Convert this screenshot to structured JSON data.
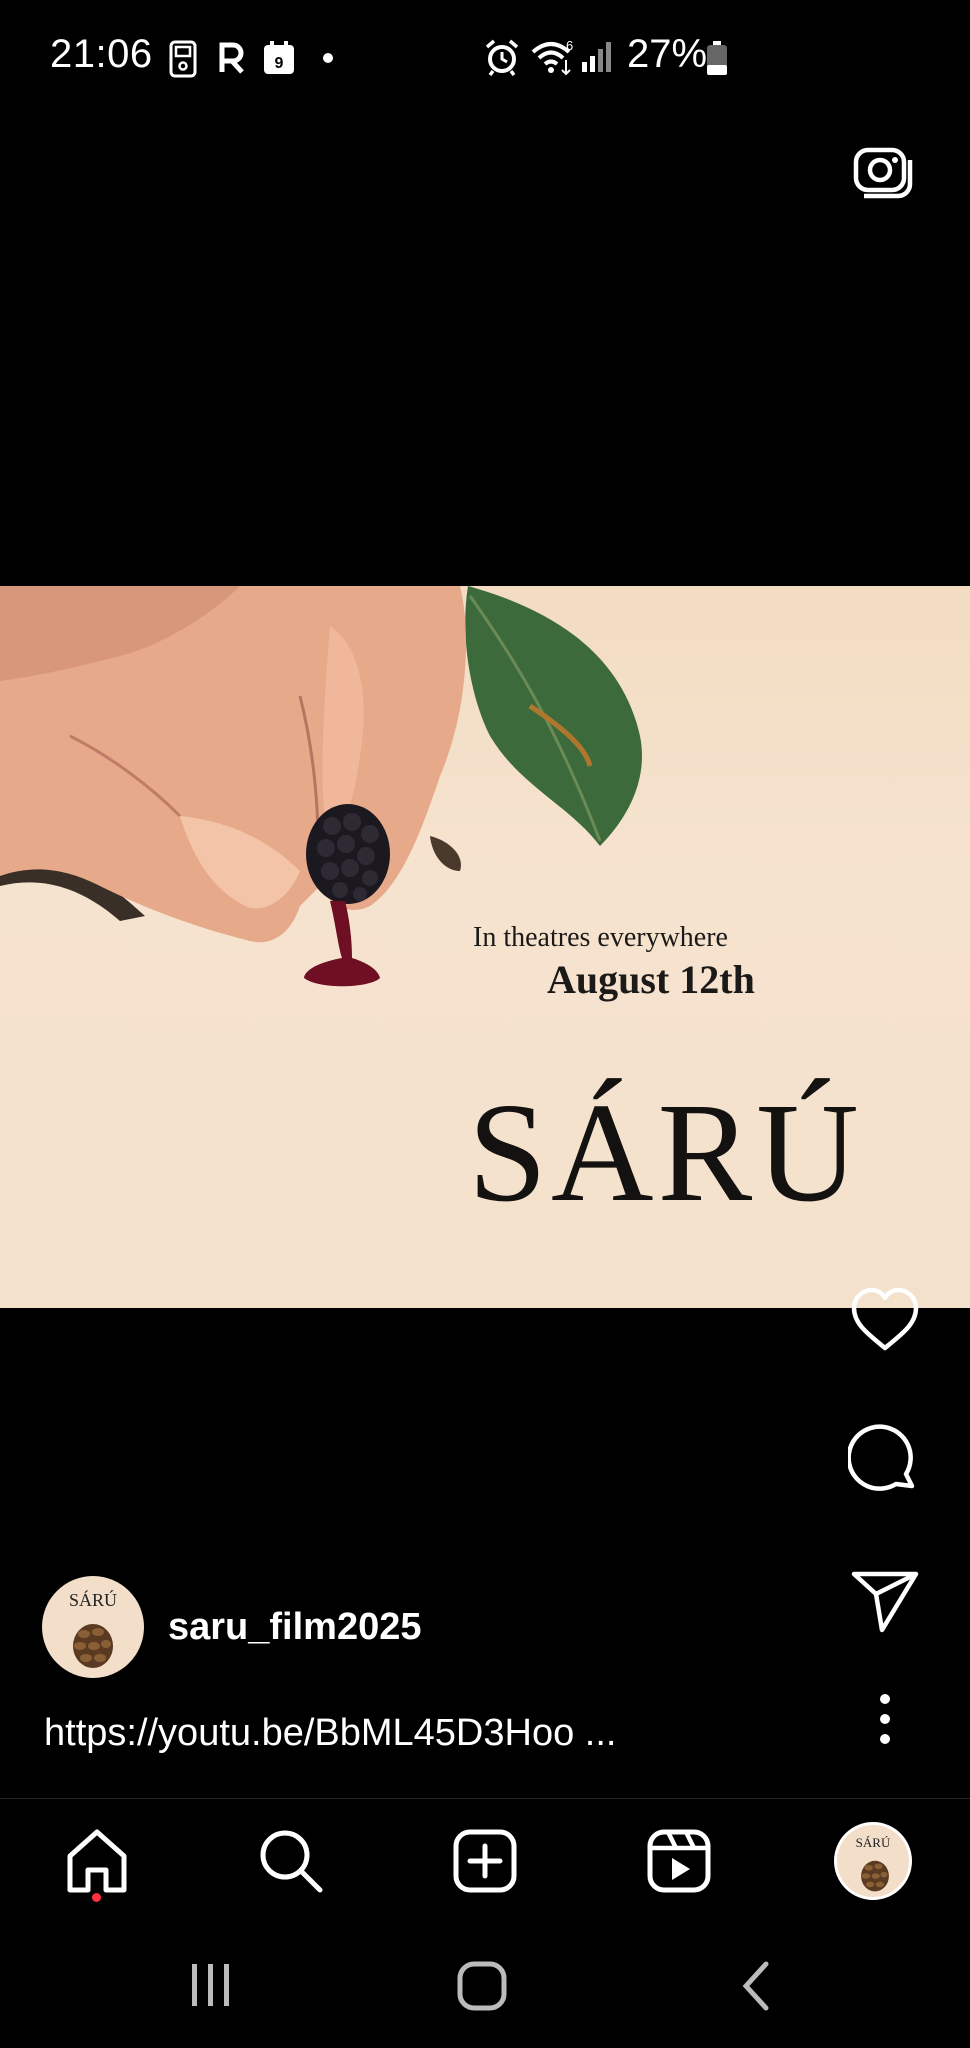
{
  "status_bar": {
    "time": "21:06",
    "calendar_day": "9",
    "battery_percent": "27%",
    "icons": [
      "phone-device-icon",
      "r-app-icon",
      "calendar-icon",
      "notification-dot-icon",
      "alarm-icon",
      "wifi-icon",
      "signal-icon",
      "battery-icon"
    ]
  },
  "top_bar": {
    "camera_icon": "camera-icon"
  },
  "post": {
    "media": {
      "text_line1": "In theatres everywhere",
      "text_line2": "August 12th",
      "title": "SÁRÚ"
    },
    "actions": [
      "like-icon",
      "comment-icon",
      "share-icon",
      "more-icon"
    ],
    "author": {
      "username": "saru_film2025",
      "avatar_text": "SÁRÚ"
    },
    "caption": "https://youtu.be/BbML45D3Hoo ..."
  },
  "bottom_nav": {
    "items": [
      "home-icon",
      "search-icon",
      "create-icon",
      "reels-icon",
      "profile-avatar"
    ],
    "active": "home",
    "avatar_text": "SÁRÚ"
  },
  "system_nav": [
    "recents-icon",
    "home-pill-icon",
    "back-icon"
  ],
  "colors": {
    "background": "#000000",
    "notification_dot": "#ff3040",
    "media_bg": "#f4e1cc"
  }
}
